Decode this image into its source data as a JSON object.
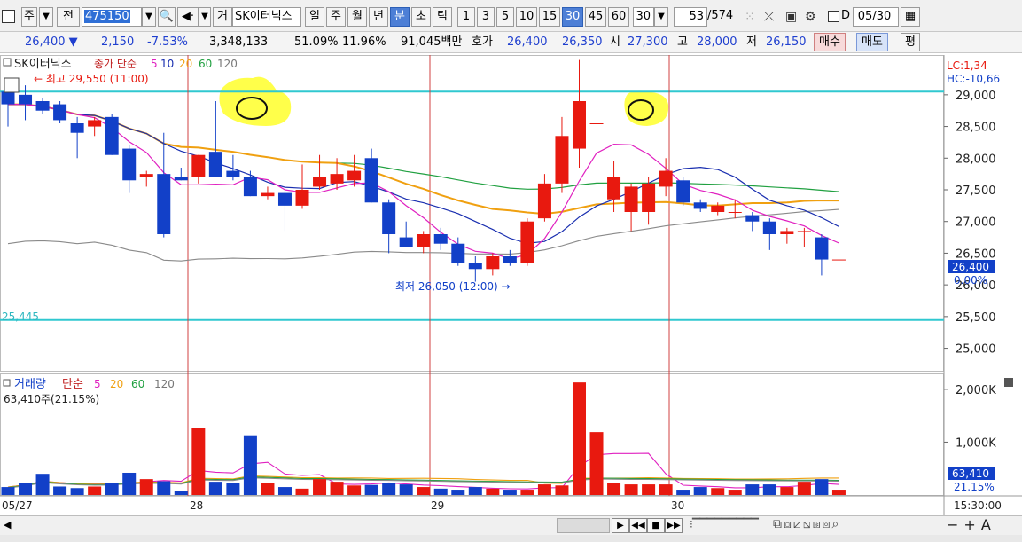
{
  "toolbar": {
    "period_label": "주",
    "prev_label": "전",
    "stock_code": "475150",
    "stock_name": "SK이터닉스",
    "type_label": "거",
    "periods": [
      "일",
      "주",
      "월",
      "년",
      "분",
      "초",
      "틱"
    ],
    "selected_period": "분",
    "intervals": [
      "1",
      "3",
      "5",
      "10",
      "15",
      "30",
      "45",
      "60"
    ],
    "selected_interval": "30",
    "interval_dropdown_value": "30",
    "bar_count": "53",
    "bar_total": "/574",
    "date_value": "05/30",
    "d_label": "D"
  },
  "info": {
    "price": "26,400",
    "change": "2,150",
    "change_pct": "-7.53%",
    "volume": "3,348,133",
    "pct_a": "51.09%",
    "pct_b": "11.96%",
    "amount": "91,045백만",
    "bid_label": "호가",
    "bid1": "26,400",
    "bid2": "26,350",
    "open_label": "시",
    "open": "27,300",
    "high_label": "고",
    "high": "28,000",
    "low_label": "저",
    "low": "26,150",
    "buy_label": "매수",
    "sell_label": "매도",
    "flat_label": "평"
  },
  "price_pane": {
    "legend_name": "SK이터닉스",
    "legend_type": "종가 단순",
    "ma_periods": [
      "5",
      "10",
      "20",
      "60",
      "120"
    ],
    "high_marker": "최고 29,550 (11:00)",
    "low_marker": "최저 26,050 (12:00)",
    "left_level_label": "25,445",
    "lc_label": "LC:1,34",
    "hc_label": "HC:-10,66",
    "current_price_tag": "26,400",
    "current_pct_tag": "0.00%",
    "y_ticks": [
      "29,000",
      "28,500",
      "28,000",
      "27,500",
      "27,000",
      "26,500",
      "26,000",
      "25,500",
      "25,000"
    ]
  },
  "volume_pane": {
    "legend_name": "거래량",
    "legend_type": "단순",
    "ma_periods": [
      "5",
      "20",
      "60",
      "120"
    ],
    "current_text": "63,410주(21.15%)",
    "current_tag": "63,410",
    "current_pct_tag": "21.15%",
    "y_ticks": [
      "2,000K",
      "1,000K"
    ]
  },
  "x_axis": {
    "labels": [
      "05/27",
      "28",
      "29",
      "30"
    ],
    "time_label": "15:30:00"
  },
  "colors": {
    "up": "#e8190f",
    "down": "#1240c8",
    "ma5": "#e020c0",
    "ma10": "#1a2fb0",
    "ma20": "#f0a010",
    "ma60": "#20a040",
    "ma120": "#8a8a8a",
    "cyan_line": "#30c8d0",
    "session_line": "#d04040",
    "highlight": "#ffff40"
  },
  "chart_data": {
    "type": "candlestick",
    "price_ylim": [
      24700,
      29600
    ],
    "volume_ylim": [
      0,
      2250000
    ],
    "candles": [
      {
        "o": 29050,
        "h": 29200,
        "l": 28500,
        "c": 28850
      },
      {
        "o": 29000,
        "h": 29150,
        "l": 28600,
        "c": 28850
      },
      {
        "o": 28900,
        "h": 28950,
        "l": 28700,
        "c": 28750
      },
      {
        "o": 28850,
        "h": 28900,
        "l": 28550,
        "c": 28600
      },
      {
        "o": 28550,
        "h": 28650,
        "l": 28000,
        "c": 28400
      },
      {
        "o": 28500,
        "h": 28650,
        "l": 28350,
        "c": 28600
      },
      {
        "o": 28650,
        "h": 28700,
        "l": 28050,
        "c": 28050
      },
      {
        "o": 28150,
        "h": 28200,
        "l": 27450,
        "c": 27650
      },
      {
        "o": 27700,
        "h": 27800,
        "l": 27550,
        "c": 27750
      },
      {
        "o": 27750,
        "h": 28400,
        "l": 26750,
        "c": 26800
      },
      {
        "o": 27700,
        "h": 27850,
        "l": 27650,
        "c": 27650
      },
      {
        "o": 27700,
        "h": 28050,
        "l": 27600,
        "c": 28050
      },
      {
        "o": 28100,
        "h": 28900,
        "l": 27700,
        "c": 27700
      },
      {
        "o": 27800,
        "h": 28050,
        "l": 27650,
        "c": 27700
      },
      {
        "o": 27700,
        "h": 27800,
        "l": 27400,
        "c": 27400
      },
      {
        "o": 27400,
        "h": 27550,
        "l": 27350,
        "c": 27450
      },
      {
        "o": 27450,
        "h": 27500,
        "l": 26850,
        "c": 27250
      },
      {
        "o": 27250,
        "h": 27900,
        "l": 27200,
        "c": 27500
      },
      {
        "o": 27550,
        "h": 28050,
        "l": 27500,
        "c": 27700
      },
      {
        "o": 27600,
        "h": 28000,
        "l": 27500,
        "c": 27750
      },
      {
        "o": 27650,
        "h": 28050,
        "l": 27550,
        "c": 27800
      },
      {
        "o": 28000,
        "h": 28150,
        "l": 27300,
        "c": 27300
      },
      {
        "o": 27300,
        "h": 27350,
        "l": 26500,
        "c": 26800
      },
      {
        "o": 26750,
        "h": 27000,
        "l": 26600,
        "c": 26600
      },
      {
        "o": 26600,
        "h": 26850,
        "l": 26500,
        "c": 26800
      },
      {
        "o": 26800,
        "h": 26900,
        "l": 26550,
        "c": 26650
      },
      {
        "o": 26650,
        "h": 26750,
        "l": 26300,
        "c": 26350
      },
      {
        "o": 26350,
        "h": 26450,
        "l": 26050,
        "c": 26250
      },
      {
        "o": 26250,
        "h": 26500,
        "l": 26150,
        "c": 26450
      },
      {
        "o": 26450,
        "h": 26550,
        "l": 26300,
        "c": 26350
      },
      {
        "o": 26350,
        "h": 27050,
        "l": 26300,
        "c": 27000
      },
      {
        "o": 27050,
        "h": 27750,
        "l": 27000,
        "c": 27600
      },
      {
        "o": 27600,
        "h": 28650,
        "l": 27450,
        "c": 28350
      },
      {
        "o": 28150,
        "h": 29550,
        "l": 27850,
        "c": 28900
      },
      {
        "o": 28550,
        "h": 28550,
        "l": 28550,
        "c": 28550
      },
      {
        "o": 27350,
        "h": 27950,
        "l": 27150,
        "c": 27700
      },
      {
        "o": 27150,
        "h": 27600,
        "l": 26850,
        "c": 27550
      },
      {
        "o": 27150,
        "h": 27700,
        "l": 26950,
        "c": 27600
      },
      {
        "o": 27550,
        "h": 28000,
        "l": 27400,
        "c": 27800
      },
      {
        "o": 27650,
        "h": 27700,
        "l": 27250,
        "c": 27300
      },
      {
        "o": 27300,
        "h": 27350,
        "l": 27150,
        "c": 27200
      },
      {
        "o": 27150,
        "h": 27300,
        "l": 27100,
        "c": 27250
      },
      {
        "o": 27150,
        "h": 27350,
        "l": 27050,
        "c": 27150
      },
      {
        "o": 27100,
        "h": 27150,
        "l": 26850,
        "c": 27000
      },
      {
        "o": 27000,
        "h": 27050,
        "l": 26550,
        "c": 26800
      },
      {
        "o": 26800,
        "h": 26900,
        "l": 26650,
        "c": 26850
      },
      {
        "o": 26850,
        "h": 26900,
        "l": 26600,
        "c": 26850
      },
      {
        "o": 26750,
        "h": 26800,
        "l": 26150,
        "c": 26400
      },
      {
        "o": 26400,
        "h": 26400,
        "l": 26400,
        "c": 26400
      }
    ],
    "volumes": [
      150000,
      230000,
      400000,
      160000,
      130000,
      160000,
      230000,
      420000,
      300000,
      260000,
      80000,
      1260000,
      250000,
      230000,
      1130000,
      220000,
      150000,
      120000,
      300000,
      250000,
      180000,
      190000,
      220000,
      200000,
      150000,
      120000,
      100000,
      150000,
      120000,
      100000,
      100000,
      200000,
      180000,
      2130000,
      1190000,
      220000,
      200000,
      200000,
      200000,
      100000,
      150000,
      130000,
      100000,
      200000,
      200000,
      150000,
      250000,
      300000,
      100000
    ]
  }
}
